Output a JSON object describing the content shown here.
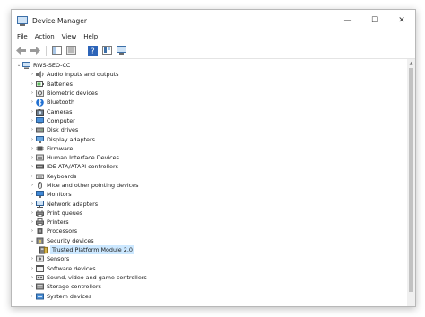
{
  "window": {
    "title": "Device Manager",
    "caption": {
      "minimize": "—",
      "maximize": "☐",
      "close": "✕"
    }
  },
  "menu": [
    "File",
    "Action",
    "View",
    "Help"
  ],
  "tree": {
    "root": {
      "label": "RWS-SEO-CC",
      "expander": "⌄"
    },
    "categories": [
      {
        "label": "Audio inputs and outputs",
        "icon": "speaker-icon"
      },
      {
        "label": "Batteries",
        "icon": "battery-icon"
      },
      {
        "label": "Biometric devices",
        "icon": "fingerprint-icon"
      },
      {
        "label": "Bluetooth",
        "icon": "bluetooth-icon"
      },
      {
        "label": "Cameras",
        "icon": "camera-icon"
      },
      {
        "label": "Computer",
        "icon": "computer-icon"
      },
      {
        "label": "Disk drives",
        "icon": "disk-icon"
      },
      {
        "label": "Display adapters",
        "icon": "display-icon"
      },
      {
        "label": "Firmware",
        "icon": "chip-icon"
      },
      {
        "label": "Human Interface Devices",
        "icon": "hid-icon"
      },
      {
        "label": "IDE ATA/ATAPI controllers",
        "icon": "controller-icon"
      },
      {
        "label": "Keyboards",
        "icon": "keyboard-icon"
      },
      {
        "label": "Mice and other pointing devices",
        "icon": "mouse-icon"
      },
      {
        "label": "Monitors",
        "icon": "monitor-icon"
      },
      {
        "label": "Network adapters",
        "icon": "network-icon"
      },
      {
        "label": "Print queues",
        "icon": "printer-icon"
      },
      {
        "label": "Printers",
        "icon": "printer-icon"
      },
      {
        "label": "Processors",
        "icon": "cpu-icon"
      },
      {
        "label": "Security devices",
        "icon": "security-icon",
        "expanded": true,
        "children": [
          {
            "label": "Trusted Platform Module 2.0",
            "icon": "tpm-icon",
            "selected": true
          }
        ]
      },
      {
        "label": "Sensors",
        "icon": "sensor-icon"
      },
      {
        "label": "Software devices",
        "icon": "software-icon"
      },
      {
        "label": "Sound, video and game controllers",
        "icon": "sound-icon"
      },
      {
        "label": "Storage controllers",
        "icon": "storage-icon"
      },
      {
        "label": "System devices",
        "icon": "system-icon"
      }
    ],
    "collapsed_glyph": "›",
    "expanded_glyph": "⌄"
  },
  "colors": {
    "selection": "#cce8ff",
    "accent": "#3c6fa8"
  }
}
